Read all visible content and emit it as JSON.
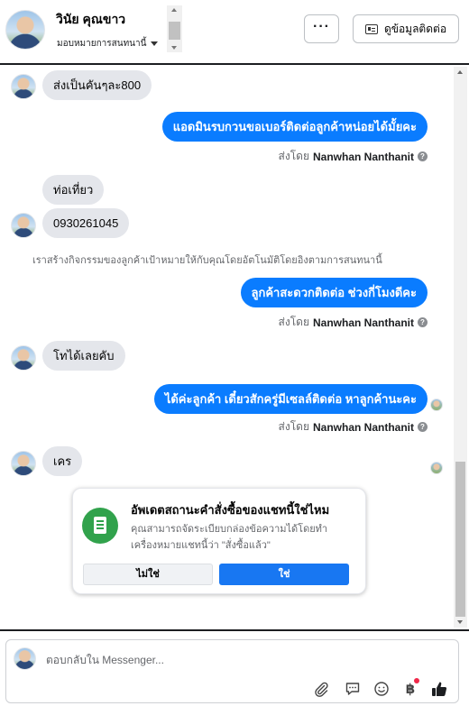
{
  "header": {
    "contact_name": "วินัย คุณขาว",
    "assign_label": "มอบหมายการสนทนานี้",
    "more_label": "···",
    "view_contact_label": "ดูข้อมูลติดต่อ"
  },
  "messages": [
    {
      "direction": "in",
      "text": "ส่งเป็นคันๆละ800"
    },
    {
      "direction": "out",
      "text": "แอดมินรบกวนขอเบอร์ติดต่อลูกค้าหน่อยได้มั้ยคะ"
    },
    {
      "direction": "in",
      "text": "ท่อเที่ยว"
    },
    {
      "direction": "in",
      "text": "0930261045"
    },
    {
      "direction": "out",
      "text": "ลูกค้าสะดวกติดต่อ ช่วงกี่โมงดีคะ"
    },
    {
      "direction": "in",
      "text": "โทได้เลยคับ"
    },
    {
      "direction": "out",
      "text": "ได้ค่ะลูกค้า เดี๋ยวสักครู่มีเซลล์ติดต่อ หาลูกค้านะคะ"
    },
    {
      "direction": "in",
      "text": "เคร"
    }
  ],
  "sent_by_prefix": "ส่งโดย",
  "sent_by_name": "Nanwhan Nanthanit",
  "system_note": "เราสร้างกิจกรรมของลูกค้าเป้าหมายให้กับคุณโดยอัตโนมัติโดยอิงตามการสนทนานี้",
  "status_card": {
    "title": "อัพเดตสถานะคำสั่งซื้อของแชทนี้ใช่ไหม",
    "desc_line1": "คุณสามารถจัดระเบียบกล่องข้อความได้โดยทำ",
    "desc_line2": "เครื่องหมายแชทนี้ว่า \"สั่งซื้อแล้ว\"",
    "no_label": "ไม่ใช่",
    "yes_label": "ใช่"
  },
  "composer": {
    "placeholder": "ตอบกลับใน Messenger..."
  },
  "colors": {
    "outgoing_bubble": "#0a7cff",
    "incoming_bubble": "#e4e6eb",
    "confirm_button": "#1877f2",
    "status_icon": "#31a24c",
    "notification_dot": "#f02849"
  },
  "icons": [
    "more-icon",
    "contact-card-icon",
    "attach-icon",
    "saved-reply-icon",
    "emoji-icon",
    "baht-payment-icon",
    "like-icon",
    "order-status-icon",
    "help-icon"
  ]
}
